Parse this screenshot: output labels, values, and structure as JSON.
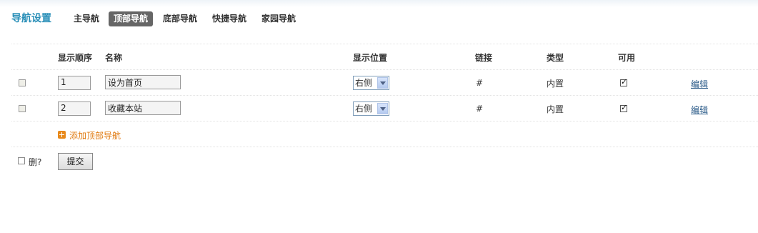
{
  "header": {
    "title": "导航设置",
    "tabs": [
      {
        "label": "主导航",
        "active": false
      },
      {
        "label": "顶部导航",
        "active": true
      },
      {
        "label": "底部导航",
        "active": false
      },
      {
        "label": "快捷导航",
        "active": false
      },
      {
        "label": "家园导航",
        "active": false
      }
    ]
  },
  "table": {
    "columns": [
      "显示顺序",
      "名称",
      "显示位置",
      "链接",
      "类型",
      "可用"
    ],
    "rows": [
      {
        "order": "1",
        "name": "设为首页",
        "position": "右侧",
        "link": "#",
        "type": "内置",
        "enabled": true,
        "edit": "编辑"
      },
      {
        "order": "2",
        "name": "收藏本站",
        "position": "右侧",
        "link": "#",
        "type": "内置",
        "enabled": true,
        "edit": "编辑"
      }
    ],
    "add_label": "添加顶部导航"
  },
  "footer": {
    "delete_label": "删?",
    "submit_label": "提交"
  },
  "colors": {
    "title": "#2a8fb8",
    "active_tab_bg": "#666666",
    "add_link": "#e07a10"
  }
}
